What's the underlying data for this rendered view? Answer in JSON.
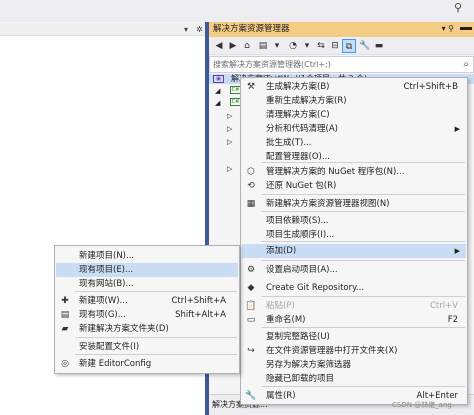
{
  "solution_explorer": {
    "title": "解决方案资源管理器",
    "search_placeholder": "搜索解决方案资源管理器(Ctrl+;)",
    "tree_root": "解决方案'TestW...'(1个项目，共 2 个)",
    "status_text": "解决方案资源..."
  },
  "main_menu": [
    {
      "label": "生成解决方案(B)",
      "shortcut": "Ctrl+Shift+B",
      "icon": "build-icon",
      "disabled": false
    },
    {
      "label": "重新生成解决方案(R)",
      "shortcut": "",
      "icon": "",
      "disabled": false
    },
    {
      "label": "清理解决方案(C)",
      "shortcut": "",
      "icon": "",
      "disabled": false
    },
    {
      "label": "分析和代码清理(A)",
      "shortcut": "",
      "icon": "",
      "disabled": false,
      "submenu": true
    },
    {
      "label": "批生成(T)...",
      "shortcut": "",
      "icon": "",
      "disabled": false
    },
    {
      "label": "配置管理器(O)...",
      "shortcut": "",
      "icon": "",
      "disabled": false
    },
    {
      "label": "管理解决方案的 NuGet 程序包(N)...",
      "shortcut": "",
      "icon": "nuget-icon",
      "disabled": false
    },
    {
      "label": "还原 NuGet 包(R)",
      "shortcut": "",
      "icon": "restore-icon",
      "disabled": false
    },
    {
      "label": "新建解决方案资源管理器视图(N)",
      "shortcut": "",
      "icon": "new-view-icon",
      "disabled": false
    },
    {
      "label": "项目依赖项(S)...",
      "shortcut": "",
      "icon": "",
      "disabled": false
    },
    {
      "label": "项目生成顺序(I)...",
      "shortcut": "",
      "icon": "",
      "disabled": false
    },
    {
      "label": "添加(D)",
      "shortcut": "",
      "icon": "",
      "disabled": false,
      "submenu": true
    },
    {
      "label": "设置启动项目(A)...",
      "shortcut": "",
      "icon": "settings-icon",
      "disabled": false
    },
    {
      "label": "Create Git Repository...",
      "shortcut": "",
      "icon": "git-icon",
      "disabled": false
    },
    {
      "label": "粘贴(P)",
      "shortcut": "Ctrl+V",
      "icon": "paste-icon",
      "disabled": true
    },
    {
      "label": "重命名(M)",
      "shortcut": "F2",
      "icon": "rename-icon",
      "disabled": false
    },
    {
      "label": "复制完整路径(U)",
      "shortcut": "",
      "icon": "",
      "disabled": false
    },
    {
      "label": "在文件资源管理器中打开文件夹(X)",
      "shortcut": "",
      "icon": "open-folder-icon",
      "disabled": false
    },
    {
      "label": "另存为解决方案筛选器",
      "shortcut": "",
      "icon": "",
      "disabled": false
    },
    {
      "label": "隐藏已卸载的项目",
      "shortcut": "",
      "icon": "",
      "disabled": false
    },
    {
      "label": "属性(R)",
      "shortcut": "Alt+Enter",
      "icon": "properties-icon",
      "disabled": false
    }
  ],
  "add_submenu": [
    {
      "label": "新建项目(N)...",
      "shortcut": "",
      "icon": ""
    },
    {
      "label": "现有项目(E)...",
      "shortcut": "",
      "icon": ""
    },
    {
      "label": "现有网站(B)...",
      "shortcut": "",
      "icon": ""
    },
    {
      "label": "新建项(W)...",
      "shortcut": "Ctrl+Shift+A",
      "icon": "new-item-icon"
    },
    {
      "label": "现有项(G)...",
      "shortcut": "Shift+Alt+A",
      "icon": "existing-item-icon"
    },
    {
      "label": "新建解决方案文件夹(D)",
      "shortcut": "",
      "icon": "new-folder-icon"
    },
    {
      "label": "安装配置文件(I)",
      "shortcut": "",
      "icon": ""
    },
    {
      "label": "新建 EditorConfig",
      "shortcut": "",
      "icon": "editorconfig-icon"
    }
  ],
  "watermark": "CSDN @林佬_ang",
  "colors": {
    "title_bar": "#f5cc84",
    "frame": "#3c5a99",
    "menu_bg": "#f6f6f6",
    "highlight": "#c9def5"
  }
}
